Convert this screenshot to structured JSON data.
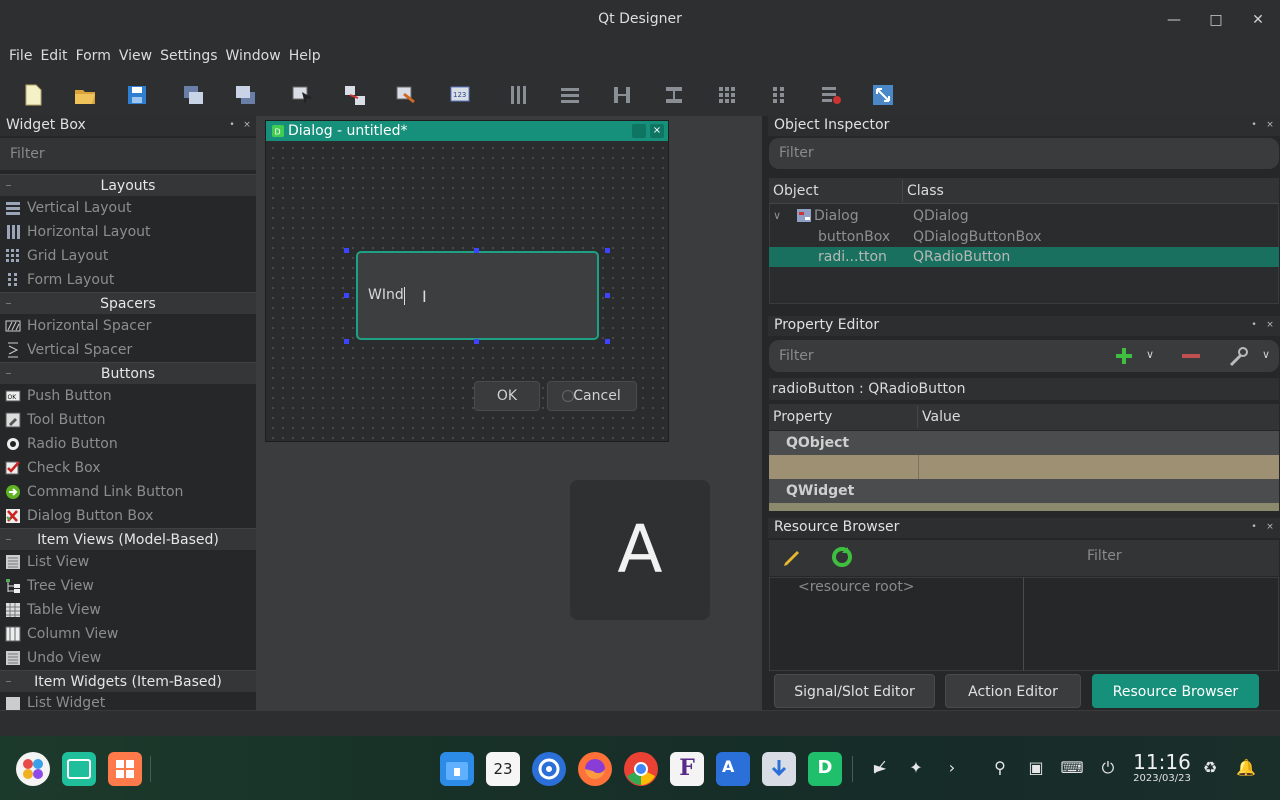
{
  "window": {
    "title": "Qt Designer"
  },
  "menu": [
    "File",
    "Edit",
    "Form",
    "View",
    "Settings",
    "Window",
    "Help"
  ],
  "widget_box": {
    "title": "Widget Box",
    "filter_placeholder": "Filter",
    "categories": [
      {
        "label": "Layouts",
        "items": [
          "Vertical Layout",
          "Horizontal Layout",
          "Grid Layout",
          "Form Layout"
        ]
      },
      {
        "label": "Spacers",
        "items": [
          "Horizontal Spacer",
          "Vertical Spacer"
        ]
      },
      {
        "label": "Buttons",
        "items": [
          "Push Button",
          "Tool Button",
          "Radio Button",
          "Check Box",
          "Command Link Button",
          "Dialog Button Box"
        ]
      },
      {
        "label": "Item Views (Model-Based)",
        "items": [
          "List View",
          "Tree View",
          "Table View",
          "Column View",
          "Undo View"
        ]
      },
      {
        "label": "Item Widgets (Item-Based)",
        "items": [
          "List Widget"
        ]
      }
    ]
  },
  "dialog": {
    "title": "Dialog - untitled*",
    "edit_text": "WInd",
    "ok_label": "OK",
    "cancel_label": "Cancel"
  },
  "osd": {
    "letter": "A"
  },
  "object_inspector": {
    "title": "Object Inspector",
    "filter_placeholder": "Filter",
    "col_object": "Object",
    "col_class": "Class",
    "rows": [
      {
        "object": "Dialog",
        "class": "QDialog"
      },
      {
        "object": "buttonBox",
        "class": "QDialogButtonBox"
      },
      {
        "object": "radi...tton",
        "class": "QRadioButton"
      }
    ]
  },
  "property_editor": {
    "title": "Property Editor",
    "filter_placeholder": "Filter",
    "object_label": "radioButton : QRadioButton",
    "col_property": "Property",
    "col_value": "Value",
    "groups": [
      "QObject",
      "QWidget"
    ]
  },
  "resource_browser": {
    "title": "Resource Browser",
    "filter_placeholder": "Filter",
    "root_label": "<resource root>"
  },
  "bottom_tabs": [
    "Signal/Slot Editor",
    "Action Editor",
    "Resource Browser"
  ],
  "taskbar": {
    "time": "11:16",
    "date": "2023/03/23",
    "calendar_day": "23"
  },
  "colors": {
    "accent": "#16907a",
    "handle": "#3d44ff"
  }
}
